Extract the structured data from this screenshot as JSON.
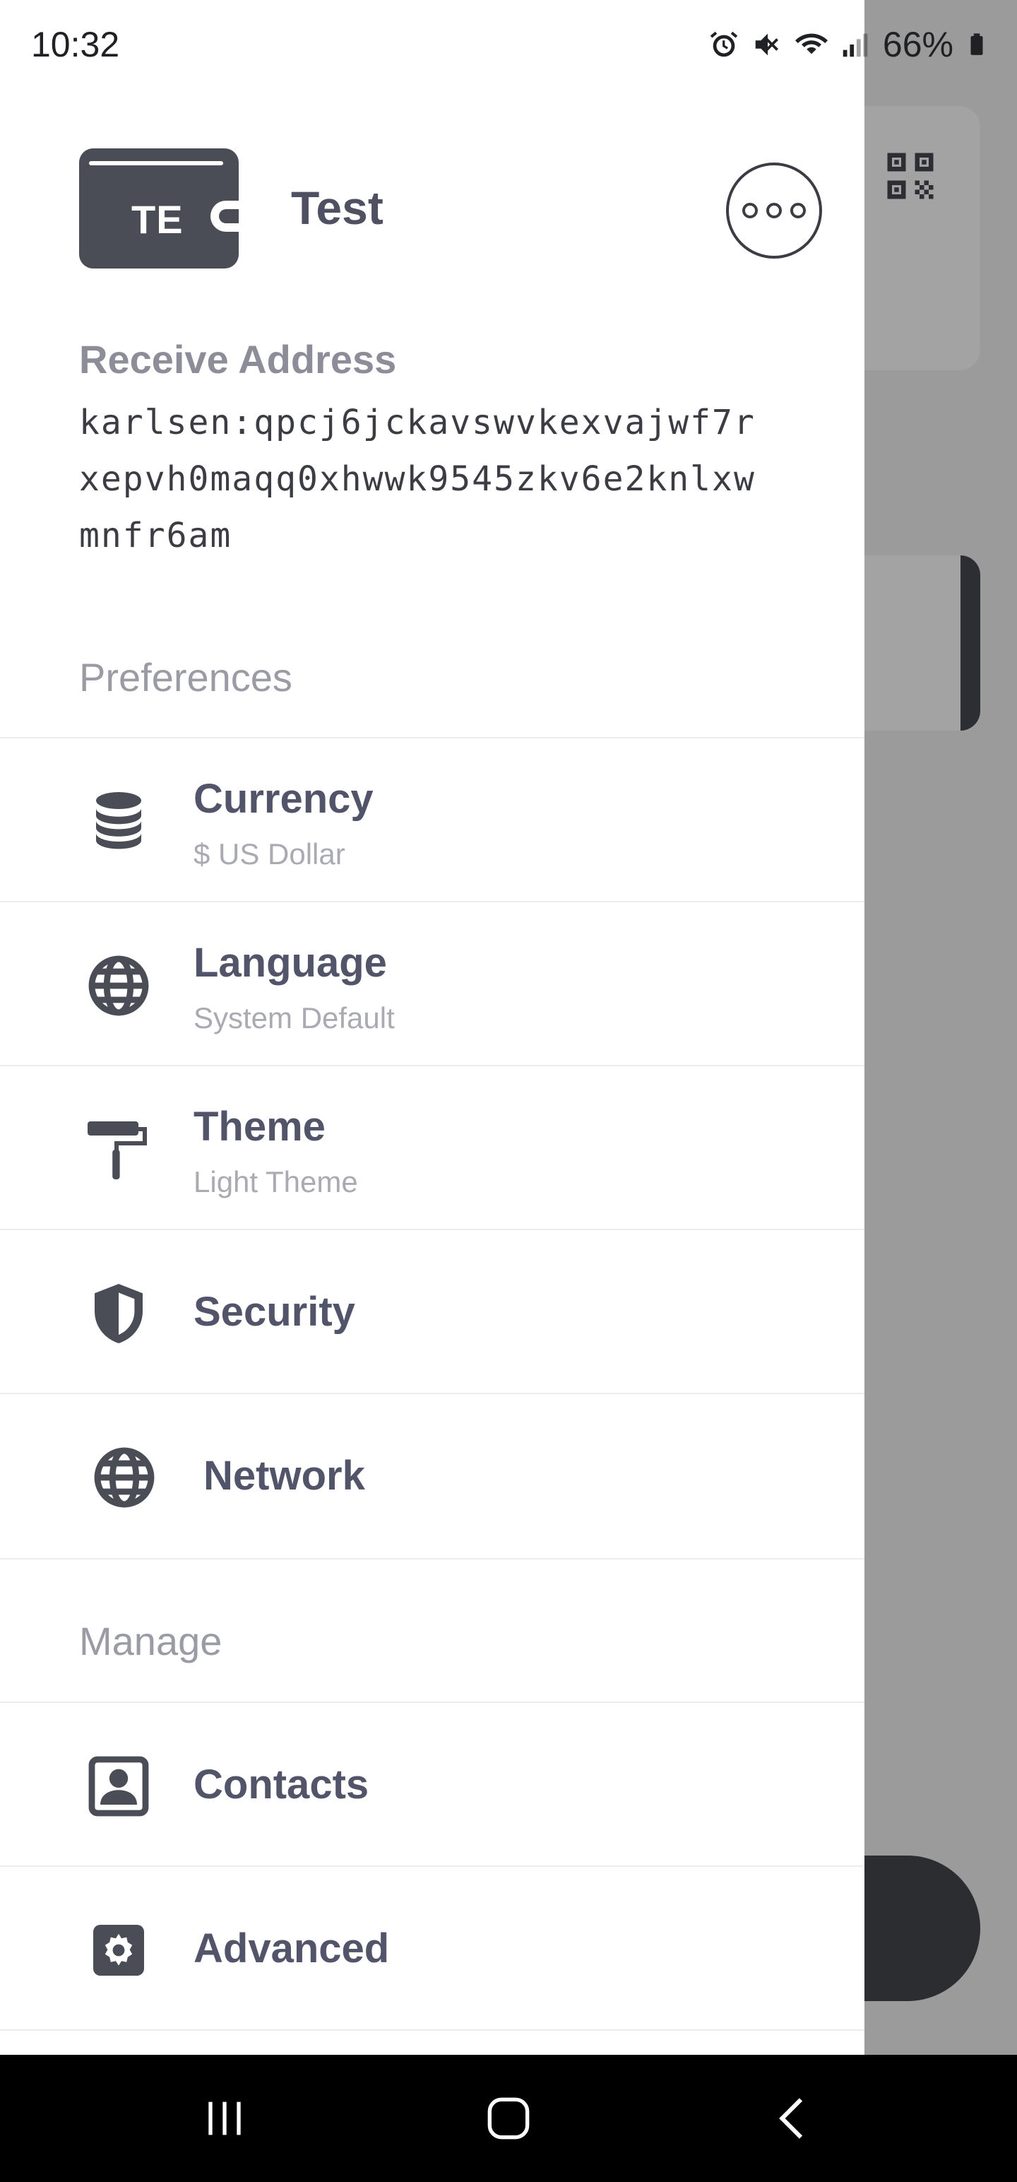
{
  "status_bar": {
    "time": "10:32",
    "battery": "66%",
    "icons": [
      "alarm-icon",
      "mute-icon",
      "wifi-icon",
      "signal-icon",
      "battery-icon"
    ]
  },
  "wallet": {
    "initials": "TE",
    "name": "Test"
  },
  "receive": {
    "label": "Receive Address",
    "address": "karlsen:qpcj6jckavswvkexvajwf7rxepvh0maqq0xhwwk9545zkv6e2knlxwmnfr6am"
  },
  "preferences": {
    "header": "Preferences",
    "items": [
      {
        "icon": "coins-icon",
        "title": "Currency",
        "subtitle": "$ US Dollar"
      },
      {
        "icon": "globe-icon",
        "title": "Language",
        "subtitle": "System Default"
      },
      {
        "icon": "paint-roller-icon",
        "title": "Theme",
        "subtitle": "Light Theme"
      },
      {
        "icon": "shield-icon",
        "title": "Security"
      },
      {
        "icon": "globe-icon",
        "title": "Network"
      }
    ]
  },
  "manage": {
    "header": "Manage",
    "items": [
      {
        "icon": "contact-card-icon",
        "title": "Contacts"
      },
      {
        "icon": "gear-icon",
        "title": "Advanced"
      }
    ]
  },
  "colors": {
    "drawer_bg": "#ffffff",
    "scrim": "#9b9b9b",
    "text_primary": "#52546a",
    "text_secondary": "#a9aab2",
    "icon": "#4a4d55"
  }
}
